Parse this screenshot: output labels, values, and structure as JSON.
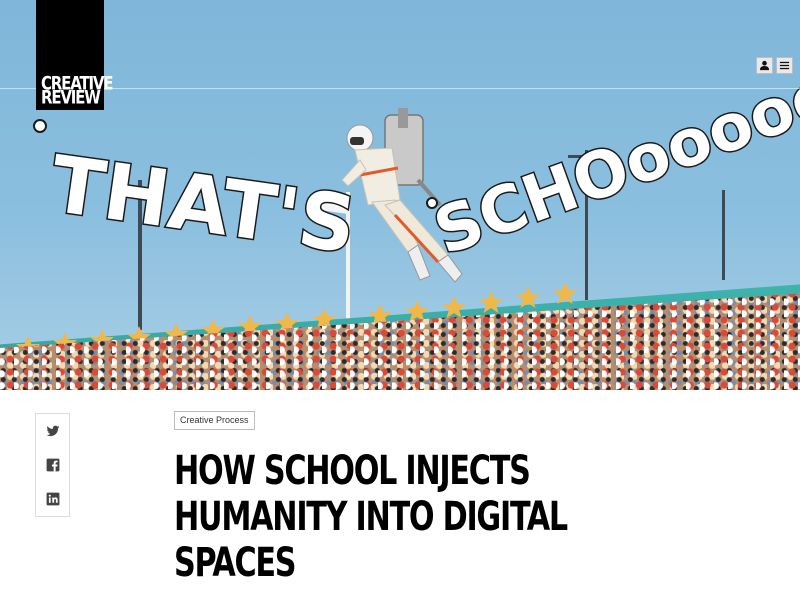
{
  "brand": {
    "logo_line1": "CREATIVE",
    "logo_line2": "REVIEW"
  },
  "header": {
    "account_icon": "user-icon",
    "menu_icon": "hamburger-menu-icon"
  },
  "hero": {
    "cloud_text_left": "THAT'S",
    "cloud_text_right": "SCHOooooool...",
    "accent_sky": "#86bcdd",
    "accent_wall": "#3fb7b0",
    "accent_stars": "#f0b849"
  },
  "share": {
    "items": [
      {
        "name": "twitter",
        "icon": "twitter-icon"
      },
      {
        "name": "facebook",
        "icon": "facebook-icon"
      },
      {
        "name": "linkedin",
        "icon": "linkedin-icon"
      }
    ]
  },
  "article": {
    "category": "Creative Process",
    "headline_line1": "HOW SCHOOL INJECTS",
    "headline_line2": "HUMANITY INTO DIGITAL",
    "headline_line3": "SPACES"
  }
}
